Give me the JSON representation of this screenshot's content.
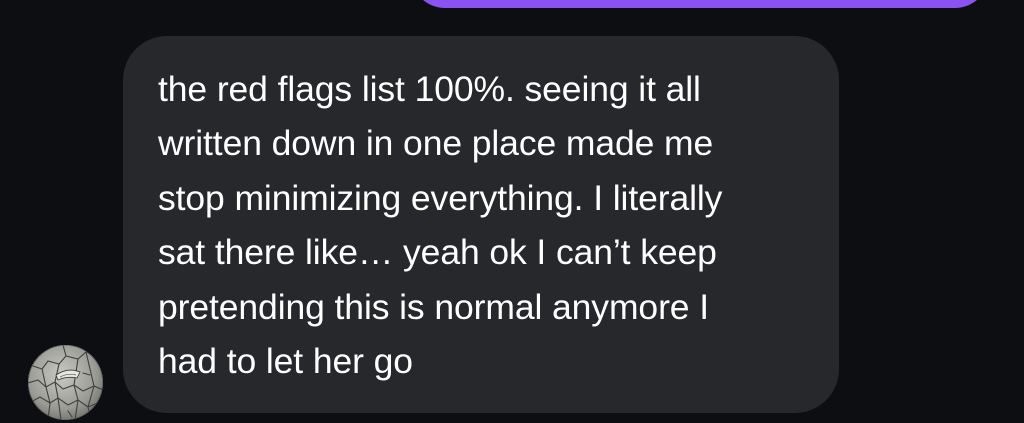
{
  "conversation": {
    "outgoing": {
      "color": "#8a52f0"
    },
    "incoming": {
      "bubble_color": "#27282c",
      "text_color": "#ffffff",
      "lines": [
        "the red flags list 100%. seeing it all",
        "written down in one place made me",
        "stop minimizing everything. I literally",
        "sat there like… yeah ok I can’t keep",
        "pretending this is normal anymore I",
        "had to let her go"
      ]
    },
    "sender": {
      "avatar_icon": "cracked-earth-with-boat-photo"
    }
  }
}
